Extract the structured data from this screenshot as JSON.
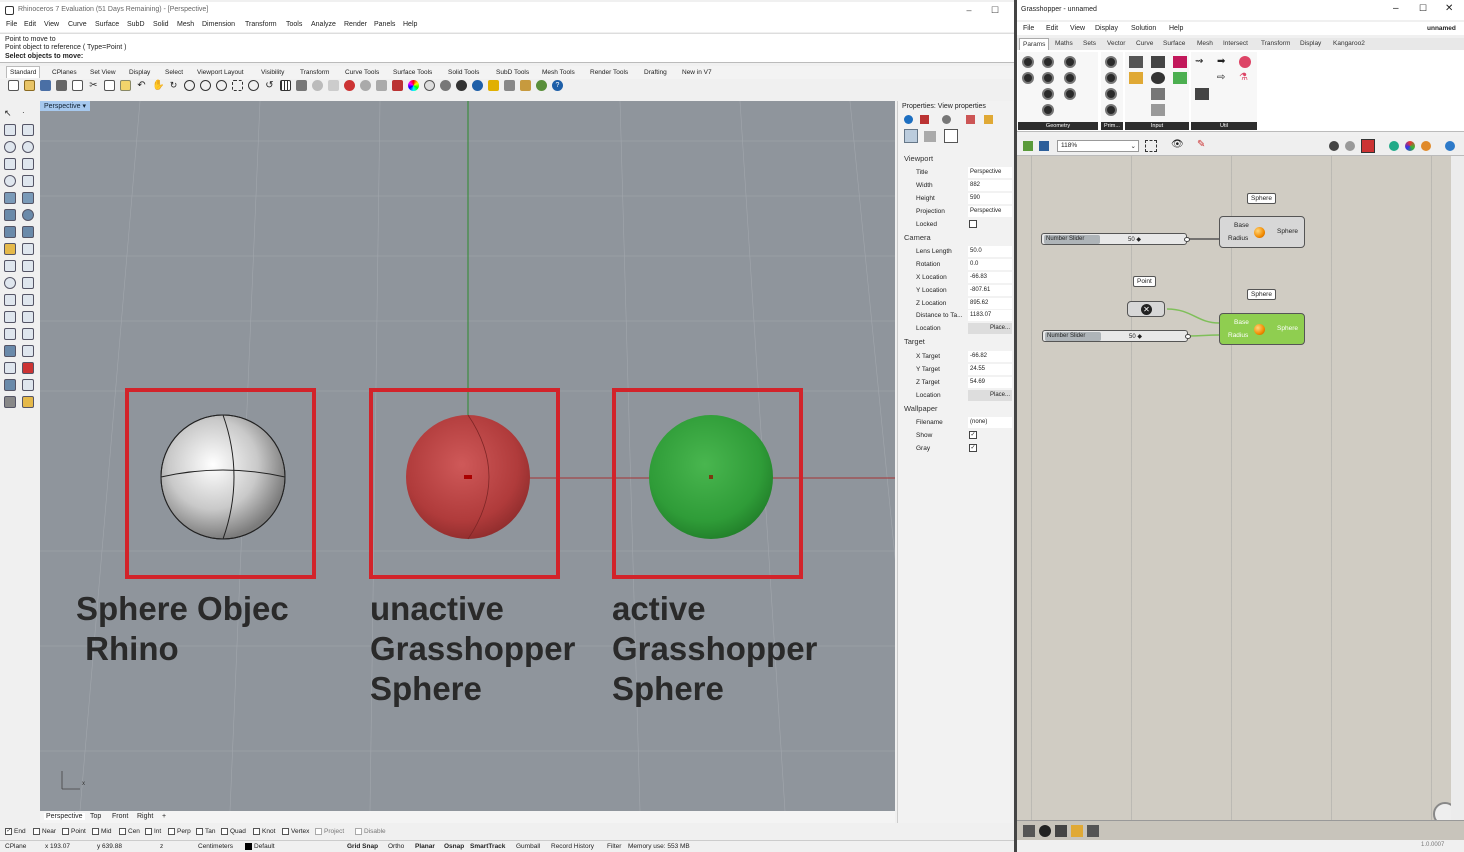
{
  "rhino": {
    "title": "Rhinoceros 7 Evaluation (51 Days Remaining) - [Perspective]",
    "menu": [
      "File",
      "Edit",
      "View",
      "Curve",
      "Surface",
      "SubD",
      "Solid",
      "Mesh",
      "Dimension",
      "Transform",
      "Tools",
      "Analyze",
      "Render",
      "Panels",
      "Help"
    ],
    "command_history": [
      "Point to move to",
      "Point object to reference ( Type=Point )"
    ],
    "command_prompt": "Select objects to move:",
    "toolbar_tabs": [
      "Standard",
      "CPlanes",
      "Set View",
      "Display",
      "Select",
      "Viewport Layout",
      "Visibility",
      "Transform",
      "Curve Tools",
      "Surface Tools",
      "Solid Tools",
      "SubD Tools",
      "Mesh Tools",
      "Render Tools",
      "Drafting",
      "New in V7"
    ],
    "viewport": {
      "label": "Perspective",
      "annotations": [
        {
          "line1": "Sphere Objec",
          "line2": " Rhino",
          "line3": ""
        },
        {
          "line1": "unactive",
          "line2": "Grasshopper",
          "line3": "Sphere"
        },
        {
          "line1": "active",
          "line2": "Grasshopper",
          "line3": "Sphere"
        }
      ],
      "axis_x": "x"
    },
    "viewport_tabs": [
      "Perspective",
      "Top",
      "Front",
      "Right"
    ],
    "osnaps": [
      {
        "label": "End",
        "checked": true
      },
      {
        "label": "Near",
        "checked": false
      },
      {
        "label": "Point",
        "checked": false
      },
      {
        "label": "Mid",
        "checked": false
      },
      {
        "label": "Cen",
        "checked": false
      },
      {
        "label": "Int",
        "checked": false
      },
      {
        "label": "Perp",
        "checked": false
      },
      {
        "label": "Tan",
        "checked": false
      },
      {
        "label": "Quad",
        "checked": false
      },
      {
        "label": "Knot",
        "checked": false
      },
      {
        "label": "Vertex",
        "checked": false
      },
      {
        "label": "Project",
        "checked": false
      },
      {
        "label": "Disable",
        "checked": false
      }
    ],
    "status": {
      "cplane": "CPlane",
      "x": "x 193.07",
      "y": "y 639.88",
      "z": "z",
      "units": "Centimeters",
      "layer": "Default",
      "toggles": [
        "Grid Snap",
        "Ortho",
        "Planar",
        "Osnap",
        "SmartTrack",
        "Gumball",
        "Record History",
        "Filter"
      ],
      "memory": "Memory use: 553 MB"
    },
    "properties": {
      "title": "Properties: View properties",
      "sections": {
        "viewport": "Viewport",
        "camera": "Camera",
        "target": "Target",
        "wallpaper": "Wallpaper"
      },
      "viewport_rows": [
        {
          "k": "Title",
          "v": "Perspective"
        },
        {
          "k": "Width",
          "v": "882"
        },
        {
          "k": "Height",
          "v": "590"
        },
        {
          "k": "Projection",
          "v": "Perspective"
        }
      ],
      "locked_label": "Locked",
      "camera_rows": [
        {
          "k": "Lens Length",
          "v": "50.0"
        },
        {
          "k": "Rotation",
          "v": "0.0"
        },
        {
          "k": "X Location",
          "v": "-66.83"
        },
        {
          "k": "Y Location",
          "v": "-807.61"
        },
        {
          "k": "Z Location",
          "v": "895.62"
        },
        {
          "k": "Distance to Ta...",
          "v": "1183.07"
        }
      ],
      "target_rows": [
        {
          "k": "X Target",
          "v": "-66.82"
        },
        {
          "k": "Y Target",
          "v": "24.55"
        },
        {
          "k": "Z Target",
          "v": "54.69"
        }
      ],
      "location_label": "Location",
      "place_button": "Place...",
      "filename_label": "Filename",
      "filename_value": "(none)",
      "show_label": "Show",
      "gray_label": "Gray"
    }
  },
  "grasshopper": {
    "title": "Grasshopper - unnamed",
    "doc_name": "unnamed",
    "menu": [
      "File",
      "Edit",
      "View",
      "Display",
      "Solution",
      "Help"
    ],
    "tabs": [
      "Params",
      "Maths",
      "Sets",
      "Vector",
      "Curve",
      "Surface",
      "Mesh",
      "Intersect",
      "Transform",
      "Display",
      "Kangaroo2"
    ],
    "ribbon_groups": [
      "Geometry",
      "Prim...",
      "Input",
      "Util"
    ],
    "zoom": "118%",
    "components": {
      "slider1": {
        "label": "Number Slider",
        "value": "50"
      },
      "slider2": {
        "label": "Number Slider",
        "value": "50"
      },
      "sphere1": {
        "bubble": "Sphere",
        "in1": "Base",
        "in2": "Radius",
        "out": "Sphere"
      },
      "sphere2": {
        "bubble": "Sphere",
        "in1": "Base",
        "in2": "Radius",
        "out": "Sphere"
      },
      "point": {
        "bubble": "Point"
      }
    },
    "version": "1.0.0007"
  }
}
